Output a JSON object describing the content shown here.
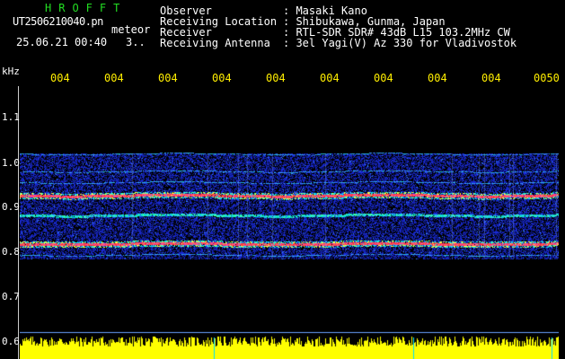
{
  "header": {
    "station_code": "HROFFT",
    "filename": "UT2506210040.pn",
    "detection_label": "meteor",
    "datetime": "25.06.21 00:40",
    "count": "3..",
    "info": [
      {
        "label": "Observer",
        "value": ": Masaki Kano"
      },
      {
        "label": "Receiving Location",
        "value": ": Shibukawa, Gunma, Japan"
      },
      {
        "label": "Receiver",
        "value": ": RTL-SDR SDR# 43dB L15 103.2MHz CW"
      },
      {
        "label": "Receiving Antenna",
        "value": ": 3el Yagi(V) Az 330 for Vladivostok"
      }
    ]
  },
  "axes": {
    "y_unit": "kHz",
    "y_ticks": [
      "1.1",
      "1.0",
      "0.9",
      "0.8",
      "0.7",
      "0.6"
    ],
    "x_ticks": [
      "004",
      "004",
      "004",
      "004",
      "004",
      "004",
      "004",
      "004",
      "004",
      "0050"
    ]
  },
  "chart_data": {
    "type": "heatmap",
    "ylabel": "kHz",
    "ylim": [
      0.6,
      1.15
    ],
    "band": [
      0.78,
      1.02
    ],
    "strong_lines_khz": [
      0.925,
      0.815
    ],
    "medium_lines_khz": [
      0.88
    ],
    "weak_lines_khz": [
      1.02,
      0.98,
      0.955,
      0.79
    ],
    "colors": {
      "noise": "#1a2bd0",
      "medium": "#00e0c0",
      "strong": "#ff3030",
      "power": "#ffff00"
    }
  }
}
